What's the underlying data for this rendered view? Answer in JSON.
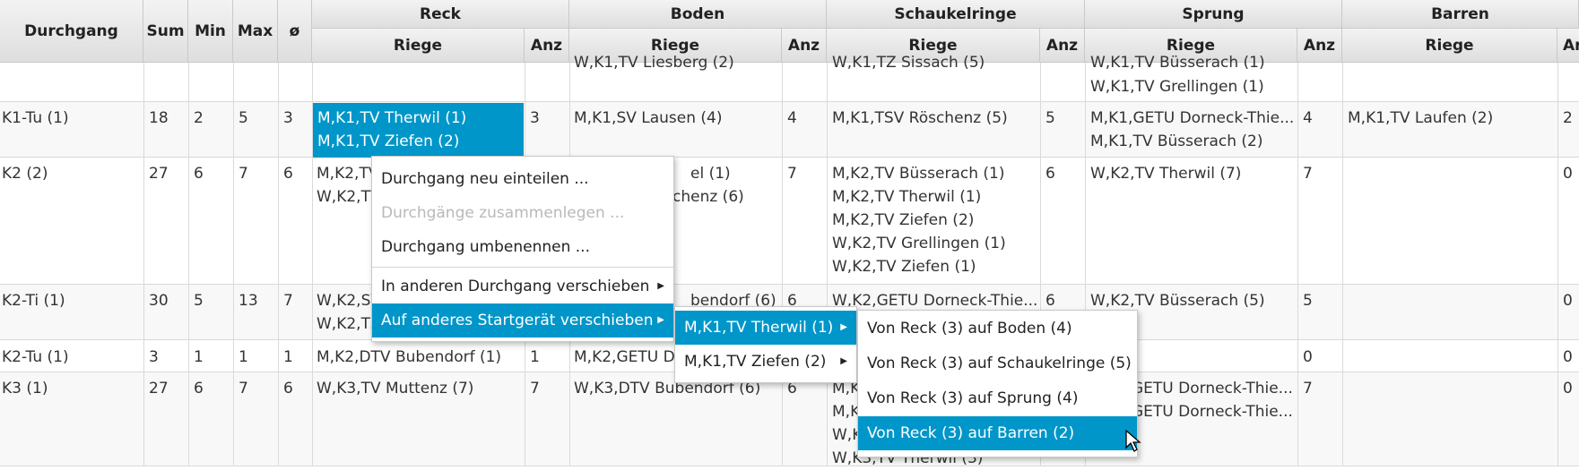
{
  "headers": {
    "durchgang": "Durchgang",
    "sum": "Sum",
    "min": "Min",
    "max": "Max",
    "avg": "ø",
    "groups": [
      "Reck",
      "Boden",
      "Schaukelringe",
      "Sprung",
      "Barren"
    ],
    "riege": "Riege",
    "anz": "Anz",
    "anz_partial": "Ar"
  },
  "rows": [
    {
      "durchgang": "",
      "sum": "",
      "min": "",
      "max": "",
      "avg": "",
      "reck": [
        ""
      ],
      "reck_anz": "",
      "boden": [
        "W,K1,TV Liesberg (2)"
      ],
      "boden_anz": "",
      "ringe": [
        "W,K1,TZ Sissach (5)"
      ],
      "ringe_anz": "",
      "sprung": [
        "W,K1,TV Büsserach (1)",
        "W,K1,TV Grellingen (1)"
      ],
      "sprung_anz": "",
      "barren": [
        ""
      ],
      "barren_anz": ""
    },
    {
      "durchgang": "K1-Tu (1)",
      "sum": "18",
      "min": "2",
      "max": "5",
      "avg": "3",
      "reck": [
        "M,K1,TV Therwil (1)",
        "M,K1,TV Ziefen (2)"
      ],
      "reck_anz": "3",
      "boden": [
        "M,K1,SV Lausen (4)"
      ],
      "boden_anz": "4",
      "ringe": [
        "M,K1,TSV Röschenz (5)"
      ],
      "ringe_anz": "5",
      "sprung": [
        "M,K1,GETU Dorneck-Thie...",
        "M,K1,TV Büsserach (2)"
      ],
      "sprung_anz": "4",
      "barren": [
        "M,K1,TV Laufen (2)"
      ],
      "barren_anz": "2"
    },
    {
      "durchgang": "K2 (2)",
      "sum": "27",
      "min": "6",
      "max": "7",
      "avg": "6",
      "reck": [
        "M,K2,TV",
        "W,K2,TV"
      ],
      "reck_anz": "",
      "boden": [
        "el (1)",
        "chenz (6)"
      ],
      "boden_anz": "7",
      "ringe": [
        "M,K2,TV Büsserach (1)",
        "M,K2,TV Therwil (1)",
        "M,K2,TV Ziefen (2)",
        "W,K2,TV Grellingen (1)",
        "W,K2,TV Ziefen (1)"
      ],
      "ringe_anz": "6",
      "sprung": [
        "W,K2,TV Therwil (7)"
      ],
      "sprung_anz": "7",
      "barren": [
        ""
      ],
      "barren_anz": "0"
    },
    {
      "durchgang": "K2-Ti (1)",
      "sum": "30",
      "min": "5",
      "max": "13",
      "avg": "7",
      "reck": [
        "W,K2,SV",
        "W,K2,TZ"
      ],
      "reck_anz": "",
      "boden": [
        "bendorf (6)"
      ],
      "boden_anz": "6",
      "ringe": [
        "W,K2,GETU Dorneck-Thie..."
      ],
      "ringe_anz": "6",
      "sprung": [
        "W,K2,TV Büsserach (5)"
      ],
      "sprung_anz": "5",
      "barren": [
        ""
      ],
      "barren_anz": "0"
    },
    {
      "durchgang": "K2-Tu (1)",
      "sum": "3",
      "min": "1",
      "max": "1",
      "avg": "1",
      "reck": [
        "M,K2,DTV Bubendorf (1)"
      ],
      "reck_anz": "1",
      "boden": [
        "M,K2,GETU D"
      ],
      "boden_anz": "",
      "ringe": [
        ""
      ],
      "ringe_anz": "",
      "sprung": [
        ""
      ],
      "sprung_anz": "0",
      "barren": [
        ""
      ],
      "barren_anz": "0"
    },
    {
      "durchgang": "K3 (1)",
      "sum": "27",
      "min": "6",
      "max": "7",
      "avg": "6",
      "reck": [
        "W,K3,TV Muttenz (7)"
      ],
      "reck_anz": "7",
      "boden": [
        "W,K3,DTV Bubendorf (6)"
      ],
      "boden_anz": "6",
      "ringe": [
        "M,K",
        "M,K",
        "W,K",
        "W,K",
        "W,K3,TV Therwil (3)"
      ],
      "ringe_anz": "",
      "sprung": [
        "GETU Dorneck-Thie...",
        "GETU Dorneck-Thie..."
      ],
      "sprung_anz": "7",
      "barren": [
        ""
      ],
      "barren_anz": "0"
    }
  ],
  "context_menu": {
    "items": [
      {
        "label": "Durchgang neu einteilen ...",
        "enabled": true
      },
      {
        "label": "Durchgänge zusammenlegen ...",
        "enabled": false
      },
      {
        "label": "Durchgang umbenennen ...",
        "enabled": true
      },
      {
        "label": "In anderen Durchgang verschieben",
        "enabled": true,
        "submenu": true
      },
      {
        "label": "Auf anderes Startgerät verschieben",
        "enabled": true,
        "submenu": true,
        "active": true
      }
    ]
  },
  "submenu_riegen": {
    "items": [
      {
        "label": "M,K1,TV Therwil (1)",
        "active": true
      },
      {
        "label": "M,K1,TV Ziefen (2)",
        "active": false
      }
    ]
  },
  "submenu_geraete": {
    "items": [
      {
        "label": "Von Reck (3) auf Boden (4)",
        "active": false
      },
      {
        "label": "Von Reck (3) auf Schaukelringe (5)",
        "active": false
      },
      {
        "label": "Von Reck (3) auf Sprung (4)",
        "active": false
      },
      {
        "label": "Von Reck (3) auf Barren (2)",
        "active": true
      }
    ]
  },
  "colors": {
    "accent": "#0096c9",
    "header_bg": "#e6e6e6",
    "disabled_text": "#b9b9b9"
  }
}
